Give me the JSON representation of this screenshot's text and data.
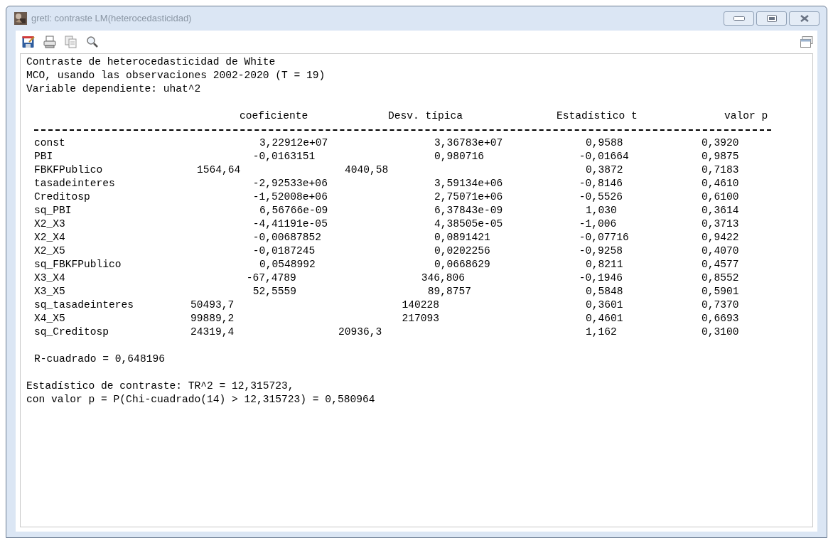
{
  "window": {
    "title": "gretl: contraste LM(heterocedasticidad)"
  },
  "output": {
    "header_lines": [
      "Contraste de heterocedasticidad de White",
      "MCO, usando las observaciones 2002-2020 (T = 19)",
      "Variable dependiente: uhat^2"
    ],
    "columns": [
      "coeficiente",
      "Desv. típica",
      "Estadístico t",
      "valor p"
    ],
    "rows": [
      {
        "name": "const",
        "cells": [
          "3,22912e+07",
          "3,36783e+07",
          "0,9588",
          "0,3920"
        ]
      },
      {
        "name": "PBI",
        "cells": [
          "-0,0163151",
          "0,980716",
          "-0,01664",
          "0,9875"
        ]
      },
      {
        "name": "FBKFPublico",
        "cells": [
          "1564,64",
          "4040,58",
          "0,3872",
          "0,7183"
        ]
      },
      {
        "name": "tasadeinteres",
        "cells": [
          "-2,92533e+06",
          "3,59134e+06",
          "-0,8146",
          "0,4610"
        ]
      },
      {
        "name": "Creditosp",
        "cells": [
          "-1,52008e+06",
          "2,75071e+06",
          "-0,5526",
          "0,6100"
        ]
      },
      {
        "name": "sq_PBI",
        "cells": [
          "6,56766e-09",
          "6,37843e-09",
          "1,030",
          "0,3614"
        ]
      },
      {
        "name": "X2_X3",
        "cells": [
          "-4,41191e-05",
          "4,38505e-05",
          "-1,006",
          "0,3713"
        ]
      },
      {
        "name": "X2_X4",
        "cells": [
          "-0,00687852",
          "0,0891421",
          "-0,07716",
          "0,9422"
        ]
      },
      {
        "name": "X2_X5",
        "cells": [
          "-0,0187245",
          "0,0202256",
          "-0,9258",
          "0,4070"
        ]
      },
      {
        "name": "sq_FBKFPublico",
        "cells": [
          "0,0548992",
          "0,0668629",
          "0,8211",
          "0,4577"
        ]
      },
      {
        "name": "X3_X4",
        "cells": [
          "-67,4789",
          "346,806",
          "-0,1946",
          "0,8552"
        ]
      },
      {
        "name": "X3_X5",
        "cells": [
          "52,5559",
          "89,8757",
          "0,5848",
          "0,5901"
        ]
      },
      {
        "name": "sq_tasadeinteres",
        "cells": [
          "50493,7",
          "140228",
          "0,3601",
          "0,7370"
        ]
      },
      {
        "name": "X4_X5",
        "cells": [
          "99889,2",
          "217093",
          "0,4601",
          "0,6693"
        ]
      },
      {
        "name": "sq_Creditosp",
        "cells": [
          "24319,4",
          "20936,3",
          "1,162",
          "0,3100"
        ]
      }
    ],
    "r_squared": "R-cuadrado = 0,648196",
    "footer_lines": [
      "Estadístico de contraste: TR^2 = 12,315723,",
      "con valor p = P(Chi-cuadrado(14) > 12,315723) = 0,580964"
    ]
  }
}
